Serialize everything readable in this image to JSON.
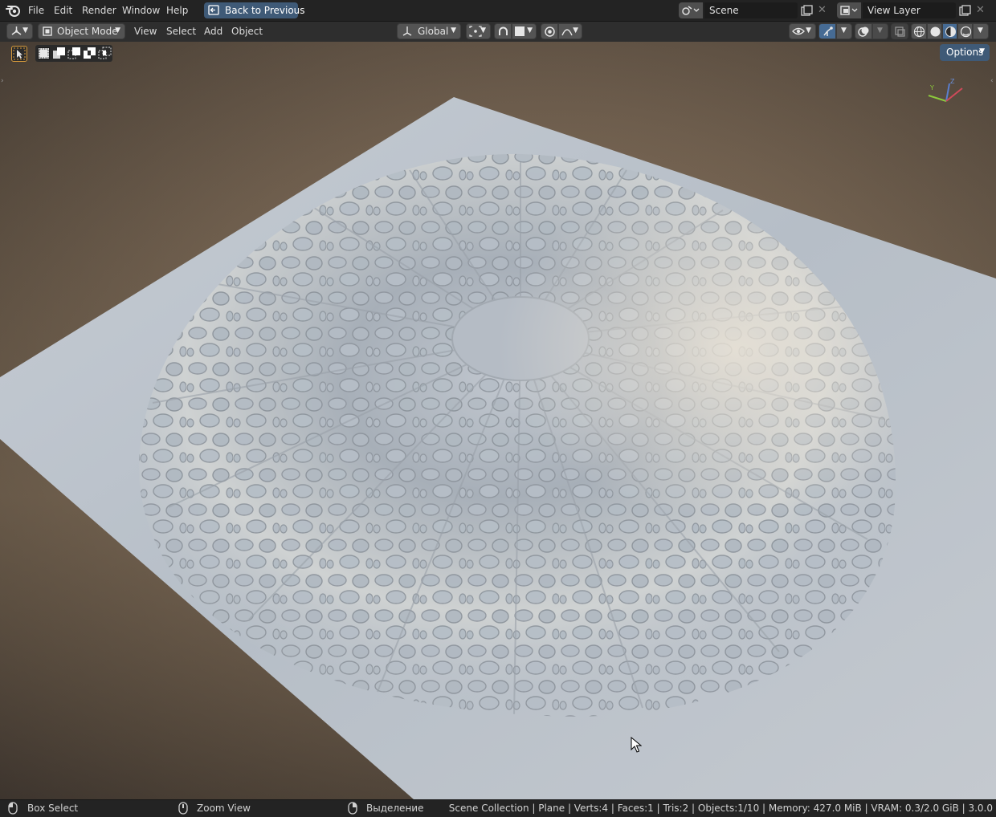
{
  "topbar": {
    "menus": [
      "File",
      "Edit",
      "Render",
      "Window",
      "Help"
    ],
    "back_button": "Back to Previous",
    "scene_name": "Scene",
    "view_layer_name": "View Layer",
    "close_glyph": "✕"
  },
  "viewport_header": {
    "editor_type_icon": "view3d-icon",
    "mode": "Object Mode",
    "menus": [
      "View",
      "Select",
      "Add",
      "Object"
    ],
    "transform_orientation": "Global"
  },
  "viewport": {
    "active_tool": "select-box-icon",
    "options_label": "Options",
    "gizmo_axes": [
      "X",
      "Y",
      "Z"
    ]
  },
  "statusbar": {
    "left_action": "Box Select",
    "middle_action": "Zoom View",
    "right_action": "Выделение",
    "info": "Scene Collection | Plane | Verts:4 | Faces:1 | Tris:2 | Objects:1/10 | Memory: 427.0 MiB | VRAM: 0.3/2.0 GiB | 3.0.0"
  },
  "colors": {
    "accent_blue": "#3f5a77",
    "active_tool_outline": "#d69a3c",
    "plane_surface": "#b7c0c8",
    "header_bg": "#2e2e2e",
    "topbar_bg": "#232323"
  }
}
